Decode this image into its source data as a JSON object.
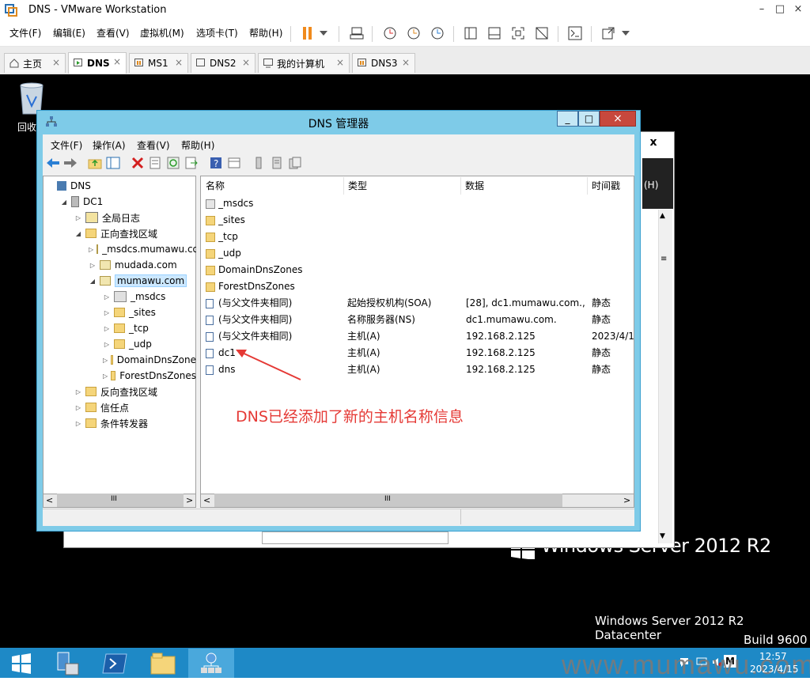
{
  "vmware": {
    "title": "DNS - VMware Workstation",
    "controls": {
      "minimize": "–",
      "maximize": "□",
      "close": "×"
    },
    "menu": [
      "文件(F)",
      "编辑(E)",
      "查看(V)",
      "虚拟机(M)",
      "选项卡(T)",
      "帮助(H)"
    ],
    "toolbar_icons": [
      "pause-icon",
      "dropdown-icon",
      "send-ctrl-alt-del-icon",
      "snapshot-icon",
      "revert-snapshot-icon",
      "snapshot-manager-icon",
      "library-view-icon",
      "thumbnail-view-icon",
      "fullscreen-icon",
      "unity-icon",
      "console-icon",
      "stretch-icon"
    ],
    "tabs": [
      {
        "label": "主页",
        "active": false
      },
      {
        "label": "DNS",
        "active": true
      },
      {
        "label": "MS1",
        "active": false
      },
      {
        "label": "DNS2",
        "active": false
      },
      {
        "label": "我的计算机",
        "active": false
      },
      {
        "label": "DNS3",
        "active": false
      }
    ],
    "tab_close": "×"
  },
  "desktop": {
    "recycle_bin_label": "回收",
    "brand_text": "Windows Server 2012 R2",
    "edition_line1": "Windows Server 2012 R2 Datacenter",
    "edition_line2": "Build 9600",
    "bg_window": {
      "close": "x",
      "frag": "(H)"
    }
  },
  "dns_manager": {
    "title": "DNS 管理器",
    "controls": {
      "minimize": "_",
      "maximize": "□",
      "close": "×"
    },
    "menu": [
      "文件(F)",
      "操作(A)",
      "查看(V)",
      "帮助(H)"
    ],
    "tree": [
      {
        "label": "DNS",
        "level": 0,
        "arrow": ""
      },
      {
        "label": "DC1",
        "level": 1,
        "arrow": "◢"
      },
      {
        "label": "全局日志",
        "level": 2,
        "arrow": "▷"
      },
      {
        "label": "正向查找区域",
        "level": 2,
        "arrow": "◢"
      },
      {
        "label": "_msdcs.mumawu.co",
        "level": 3,
        "arrow": "▷"
      },
      {
        "label": "mudada.com",
        "level": 3,
        "arrow": "▷"
      },
      {
        "label": "mumawu.com",
        "level": 3,
        "arrow": "◢",
        "selected": true
      },
      {
        "label": "_msdcs",
        "level": 4,
        "arrow": "▷"
      },
      {
        "label": "_sites",
        "level": 4,
        "arrow": "▷"
      },
      {
        "label": "_tcp",
        "level": 4,
        "arrow": "▷"
      },
      {
        "label": "_udp",
        "level": 4,
        "arrow": "▷"
      },
      {
        "label": "DomainDnsZone",
        "level": 4,
        "arrow": "▷"
      },
      {
        "label": "ForestDnsZones",
        "level": 4,
        "arrow": "▷"
      },
      {
        "label": "反向查找区域",
        "level": 2,
        "arrow": "▷"
      },
      {
        "label": "信任点",
        "level": 2,
        "arrow": "▷"
      },
      {
        "label": "条件转发器",
        "level": 2,
        "arrow": "▷"
      }
    ],
    "columns": [
      "名称",
      "类型",
      "数据",
      "时间戳"
    ],
    "rows": [
      {
        "name": "_msdcs",
        "type": "",
        "data": "",
        "time": ""
      },
      {
        "name": "_sites",
        "type": "",
        "data": "",
        "time": ""
      },
      {
        "name": "_tcp",
        "type": "",
        "data": "",
        "time": ""
      },
      {
        "name": "_udp",
        "type": "",
        "data": "",
        "time": ""
      },
      {
        "name": "DomainDnsZones",
        "type": "",
        "data": "",
        "time": ""
      },
      {
        "name": "ForestDnsZones",
        "type": "",
        "data": "",
        "time": ""
      },
      {
        "name": "(与父文件夹相同)",
        "type": "起始授权机构(SOA)",
        "data": "[28], dc1.mumawu.com.,...",
        "time": "静态"
      },
      {
        "name": "(与父文件夹相同)",
        "type": "名称服务器(NS)",
        "data": "dc1.mumawu.com.",
        "time": "静态"
      },
      {
        "name": "(与父文件夹相同)",
        "type": "主机(A)",
        "data": "192.168.2.125",
        "time": "2023/4/1"
      },
      {
        "name": "dc1",
        "type": "主机(A)",
        "data": "192.168.2.125",
        "time": "静态"
      },
      {
        "name": "dns",
        "type": "主机(A)",
        "data": "192.168.2.125",
        "time": "静态"
      }
    ],
    "scroll": {
      "left": "<",
      "right": ">",
      "thumb": "III"
    },
    "annotation": "DNS已经添加了新的主机名称信息"
  },
  "taskbar": {
    "time": "12:57",
    "date": "2023/4/15",
    "tray_letter": "M",
    "watermark": "www.mumawu.com"
  }
}
